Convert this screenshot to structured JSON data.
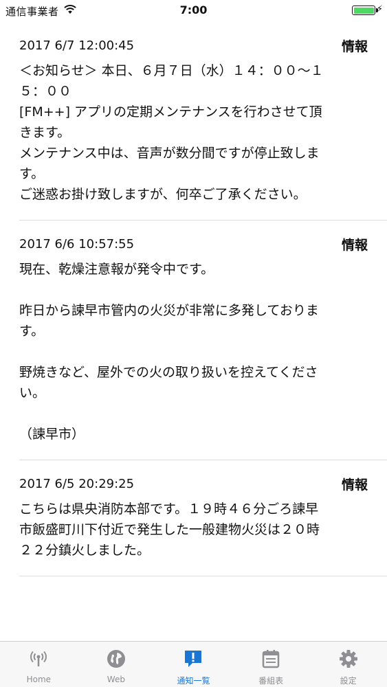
{
  "status_bar": {
    "carrier": "通信事業者",
    "time": "7:00"
  },
  "notices": [
    {
      "date": "2017 6/7 12:00:45",
      "type": "情報",
      "body": "＜お知らせ＞ 本日、６月７日（水）１４：００～１\n５：００\n[FM++] アプリの定期メンテナンスを行わさせて頂\nきます。\nメンテナンス中は、音声が数分間ですが停止致しま\nす。\nご迷惑お掛け致しますが、何卒ご了承ください。"
    },
    {
      "date": "2017 6/6 10:57:55",
      "type": "情報",
      "body": "現在、乾燥注意報が発令中です。\n\n昨日から諫早市管内の火災が非常に多発しておりま\nす。\n\n野焼きなど、屋外での火の取り扱いを控えてくださ\nい。\n\n（諫早市）"
    },
    {
      "date": "2017 6/5 20:29:25",
      "type": "情報",
      "body": "こちらは県央消防本部です。１９時４６分ごろ諫早\n市飯盛町川下付近で発生した一般建物火災は２０時\n２２分鎮火しました。"
    }
  ],
  "tabs": [
    {
      "label": "Home",
      "icon": "antenna-icon"
    },
    {
      "label": "Web",
      "icon": "globe-icon"
    },
    {
      "label": "通知一覧",
      "icon": "notice-icon"
    },
    {
      "label": "番組表",
      "icon": "calendar-icon"
    },
    {
      "label": "設定",
      "icon": "gear-icon"
    }
  ],
  "colors": {
    "accent": "#1b76d3",
    "inactive": "#8e8e93",
    "battery": "#4cd964"
  }
}
